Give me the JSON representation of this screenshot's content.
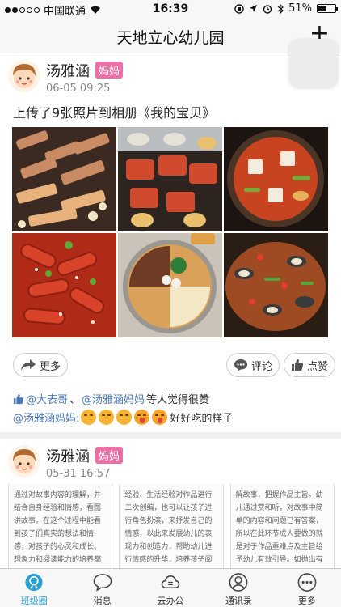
{
  "status": {
    "carrier": "中国联通",
    "time": "16:39",
    "battery": "51%",
    "battery_level": 0.51
  },
  "nav": {
    "title": "天地立心幼儿园",
    "add_icon": "plus-icon"
  },
  "posts": [
    {
      "author": "汤雅涵",
      "role": "妈妈",
      "time": "06-05 09:25",
      "text": "上传了9张照片到相册《我的宝贝》",
      "photos": [
        "bbq-pork",
        "grilled-seafood",
        "kimchi-stew",
        "tteokbokki",
        "hotpot",
        "seafood-stirfry"
      ],
      "actions": {
        "more": "更多",
        "comment": "评论",
        "like": "点赞"
      },
      "likes": {
        "users": [
          "@大表哥",
          "@汤雅涵妈妈"
        ],
        "separator": "、",
        "suffix": " 等人觉得很赞"
      },
      "comment": {
        "author": "@汤雅涵妈妈:",
        "text": "好好吃的样子"
      }
    },
    {
      "author": "汤雅涵",
      "role": "妈妈",
      "time": "05-31 16:57",
      "doc_pages": [
        "通过对故事内容的理解，并结合自身经验和情感，看图讲故事。在这个过程中能看到孩子们真实的想法和情感，对孩子的心灵和成长、想象力和阅读能力的培养都具有不可估量的",
        "经验、生活经验对作品进行二次创编，也可以让孩子进行角色扮演，来抒发自己的情感，以此来发展幼儿的表现力和创造力，帮助幼儿进行情感的升华，培养孩子阅读的兴趣及爱",
        "解故事，把握作品主旨。幼儿通过赏和听，对故事中简单的内容和问题已有答案，所以在此环节成人要做的就是对于作品重难点及主旨给予幼儿有效引导。如抛出有价值的问题，"
      ]
    }
  ],
  "tabs": [
    {
      "label": "班级圈",
      "icon": "class-circle-icon",
      "active": true
    },
    {
      "label": "消息",
      "icon": "message-icon",
      "active": false
    },
    {
      "label": "云办公",
      "icon": "cloud-office-icon",
      "active": false
    },
    {
      "label": "通讯录",
      "icon": "contacts-icon",
      "active": false
    },
    {
      "label": "更多",
      "icon": "more-icon",
      "active": false
    }
  ],
  "colors": {
    "accent": "#25a1d6",
    "badge": "#ec6fa6",
    "link": "#4a78b8"
  }
}
